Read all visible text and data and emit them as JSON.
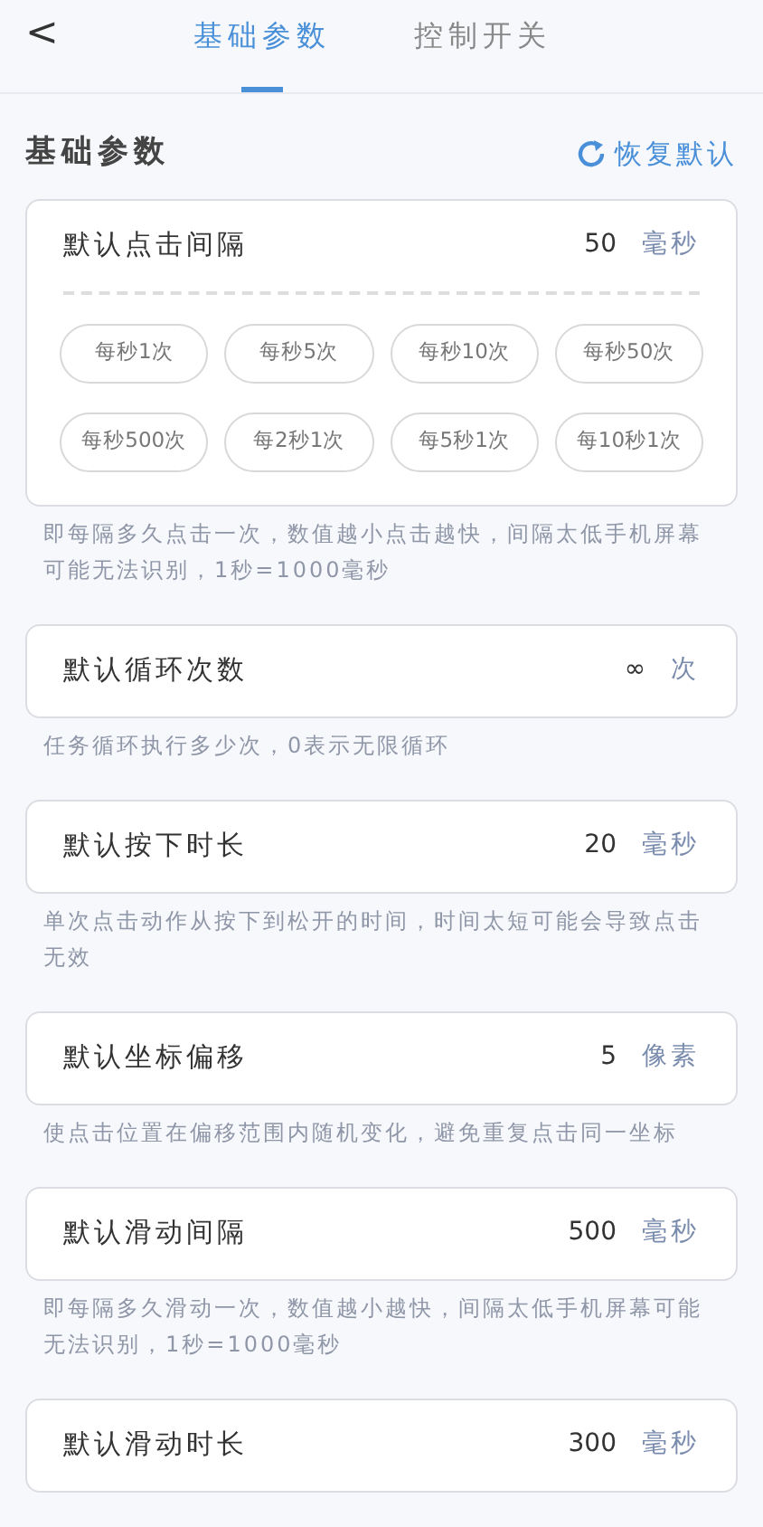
{
  "header": {
    "back": "<",
    "tabs": [
      {
        "label": "基础参数",
        "selected": true
      },
      {
        "label": "控制开关",
        "selected": false
      }
    ]
  },
  "section": {
    "title": "基础参数",
    "reset": "恢复默认"
  },
  "settings": [
    {
      "label": "默认点击间隔",
      "value": "50",
      "unit": "毫秒",
      "presets": [
        "每秒1次",
        "每秒5次",
        "每秒10次",
        "每秒50次",
        "每秒500次",
        "每2秒1次",
        "每5秒1次",
        "每10秒1次"
      ],
      "tip": "即每隔多久点击一次，数值越小点击越快，间隔太低手机屏幕可能无法识别，1秒=1000毫秒"
    },
    {
      "label": "默认循环次数",
      "value": "∞",
      "unit": "次",
      "tip": "任务循环执行多少次，0表示无限循环"
    },
    {
      "label": "默认按下时长",
      "value": "20",
      "unit": "毫秒",
      "tip": "单次点击动作从按下到松开的时间，时间太短可能会导致点击无效"
    },
    {
      "label": "默认坐标偏移",
      "value": "5",
      "unit": "像素",
      "tip": "使点击位置在偏移范围内随机变化，避免重复点击同一坐标"
    },
    {
      "label": "默认滑动间隔",
      "value": "500",
      "unit": "毫秒",
      "tip": "即每隔多久滑动一次，数值越小越快，间隔太低手机屏幕可能无法识别，1秒=1000毫秒"
    },
    {
      "label": "默认滑动时长",
      "value": "300",
      "unit": "毫秒"
    }
  ]
}
